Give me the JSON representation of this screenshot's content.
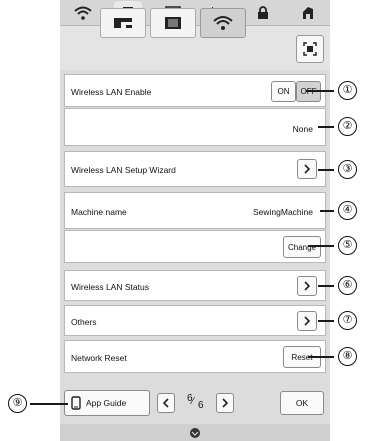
{
  "top_tabs": [
    {
      "icon": "wifi-icon"
    },
    {
      "icon": "page-icon"
    },
    {
      "icon": "help-icon"
    },
    {
      "icon": "presser-foot-icon"
    },
    {
      "icon": "lock-icon"
    },
    {
      "icon": "embroidery-icon"
    }
  ],
  "sub_tabs": [
    {
      "icon": "sewing-machine-icon"
    },
    {
      "icon": "embroidery-unit-icon"
    },
    {
      "icon": "wifi-icon"
    }
  ],
  "rows": {
    "wlan_enable": {
      "label": "Wireless LAN Enable",
      "on": "ON",
      "off": "OFF",
      "selected": "OFF"
    },
    "network_name": {
      "value": "None"
    },
    "setup_wizard": {
      "label": "Wireless LAN Setup Wizard"
    },
    "machine_name": {
      "label": "Machine name",
      "value": "SewingMachine"
    },
    "change": {
      "label": "Change"
    },
    "status": {
      "label": "Wireless LAN Status"
    },
    "others": {
      "label": "Others"
    },
    "reset": {
      "label": "Network Reset",
      "button": "Reset"
    }
  },
  "footer": {
    "app_guide": "App Guide",
    "page_current": "6",
    "page_total": "6",
    "ok": "OK"
  },
  "callouts": [
    "①",
    "②",
    "③",
    "④",
    "⑤",
    "⑥",
    "⑦",
    "⑧",
    "⑨"
  ],
  "colors": {
    "panel": "#dcdcdc",
    "row_bg": "#ffffff",
    "callout_line": "#1a1a1a"
  }
}
